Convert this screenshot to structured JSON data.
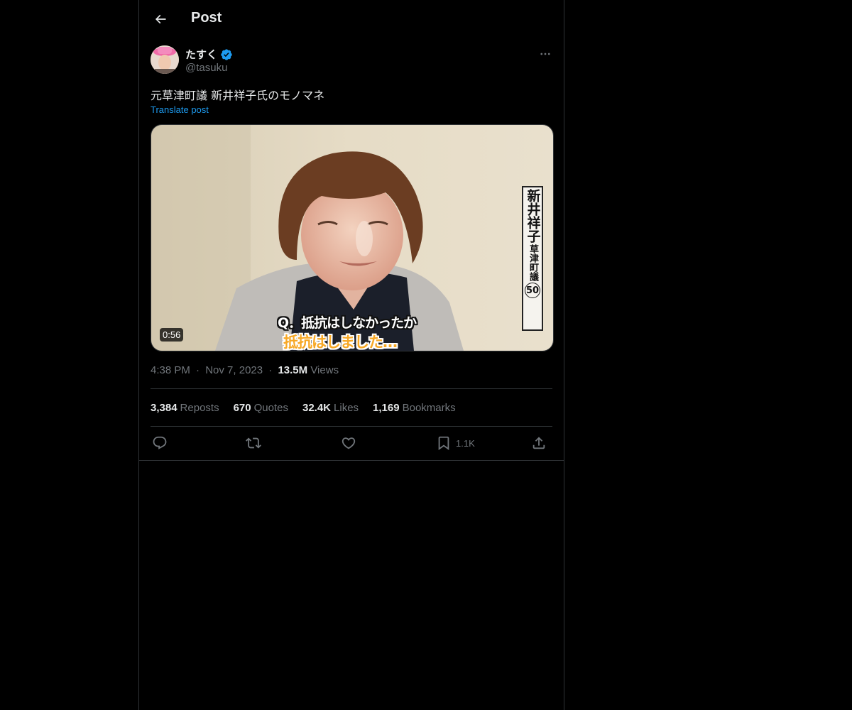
{
  "header": {
    "title": "Post",
    "back_icon": "arrow-left-icon"
  },
  "author": {
    "name": "たすく",
    "handle": "@tasuku",
    "verified": true,
    "avatar_icon": "avatar-pink-hat"
  },
  "tweet": {
    "text": "元草津町議 新井祥子氏のモノマネ",
    "translate_label": "Translate post"
  },
  "media": {
    "duration": "0:56",
    "caption_line1": "Q．抵抗はしなかったか",
    "caption_line2": "抵抗はしました…",
    "nameplate_name": "新井祥子",
    "nameplate_title": "草津町議",
    "nameplate_age": "50"
  },
  "meta": {
    "time": "4:38 PM",
    "sep": "·",
    "date": "Nov 7, 2023",
    "views_count": "13.5M",
    "views_label": "Views"
  },
  "stats": [
    {
      "count": "3,384",
      "label": "Reposts"
    },
    {
      "count": "670",
      "label": "Quotes"
    },
    {
      "count": "32.4K",
      "label": "Likes"
    },
    {
      "count": "1,169",
      "label": "Bookmarks"
    }
  ],
  "actions": {
    "reply_icon": "reply-icon",
    "repost_icon": "repost-icon",
    "like_icon": "heart-icon",
    "bookmark_icon": "bookmark-icon",
    "bookmark_count": "1.1K",
    "share_icon": "share-icon"
  },
  "colors": {
    "background": "#000000",
    "text": "#e7e9ea",
    "muted": "#71767b",
    "accent": "#1d9bf0",
    "border": "#2f3336",
    "caption_orange": "#f7a826"
  }
}
